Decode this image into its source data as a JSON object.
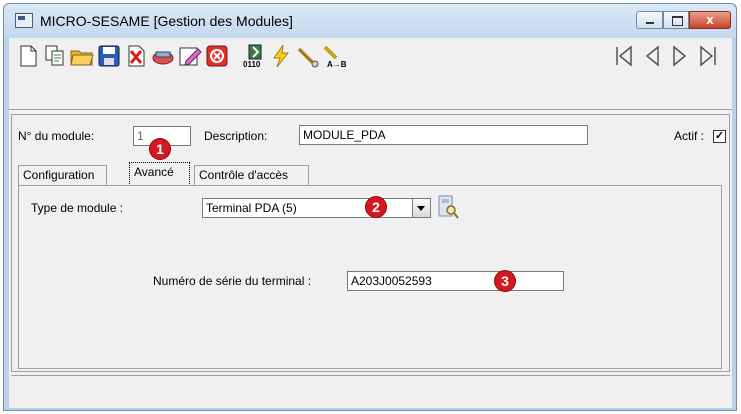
{
  "window": {
    "title": "MICRO-SESAME [Gestion des Modules]",
    "close_glyph": "x"
  },
  "toolbar": {
    "buttons": [
      "new-icon",
      "copy-icon",
      "open-folder-icon",
      "save-icon",
      "delete-icon",
      "link-icon",
      "edit-icon",
      "cancel-icon",
      "binary-icon",
      "lightning-icon",
      "wand-icon",
      "transfer-icon"
    ],
    "nav": [
      "first-record-icon",
      "previous-record-icon",
      "next-record-icon",
      "last-record-icon"
    ]
  },
  "form": {
    "module_number_label": "N° du module:",
    "module_number_value": "1",
    "description_label": "Description:",
    "description_value": "MODULE_PDA",
    "active_label": "Actif :",
    "active_checked": "✓"
  },
  "tabs": [
    {
      "label": "Configuration"
    },
    {
      "label": "Avancé"
    },
    {
      "label": "Contrôle d'accès"
    }
  ],
  "advanced": {
    "module_type_label": "Type de module :",
    "module_type_value": "Terminal PDA (5)",
    "serial_label": "Numéro de série du terminal :",
    "serial_value": "A203J0052593"
  },
  "markers": [
    "1",
    "2",
    "3"
  ],
  "colors": {
    "marker_red": "#d41820",
    "titlebar": "#c4d8ee",
    "panel": "#f0f0f0"
  }
}
